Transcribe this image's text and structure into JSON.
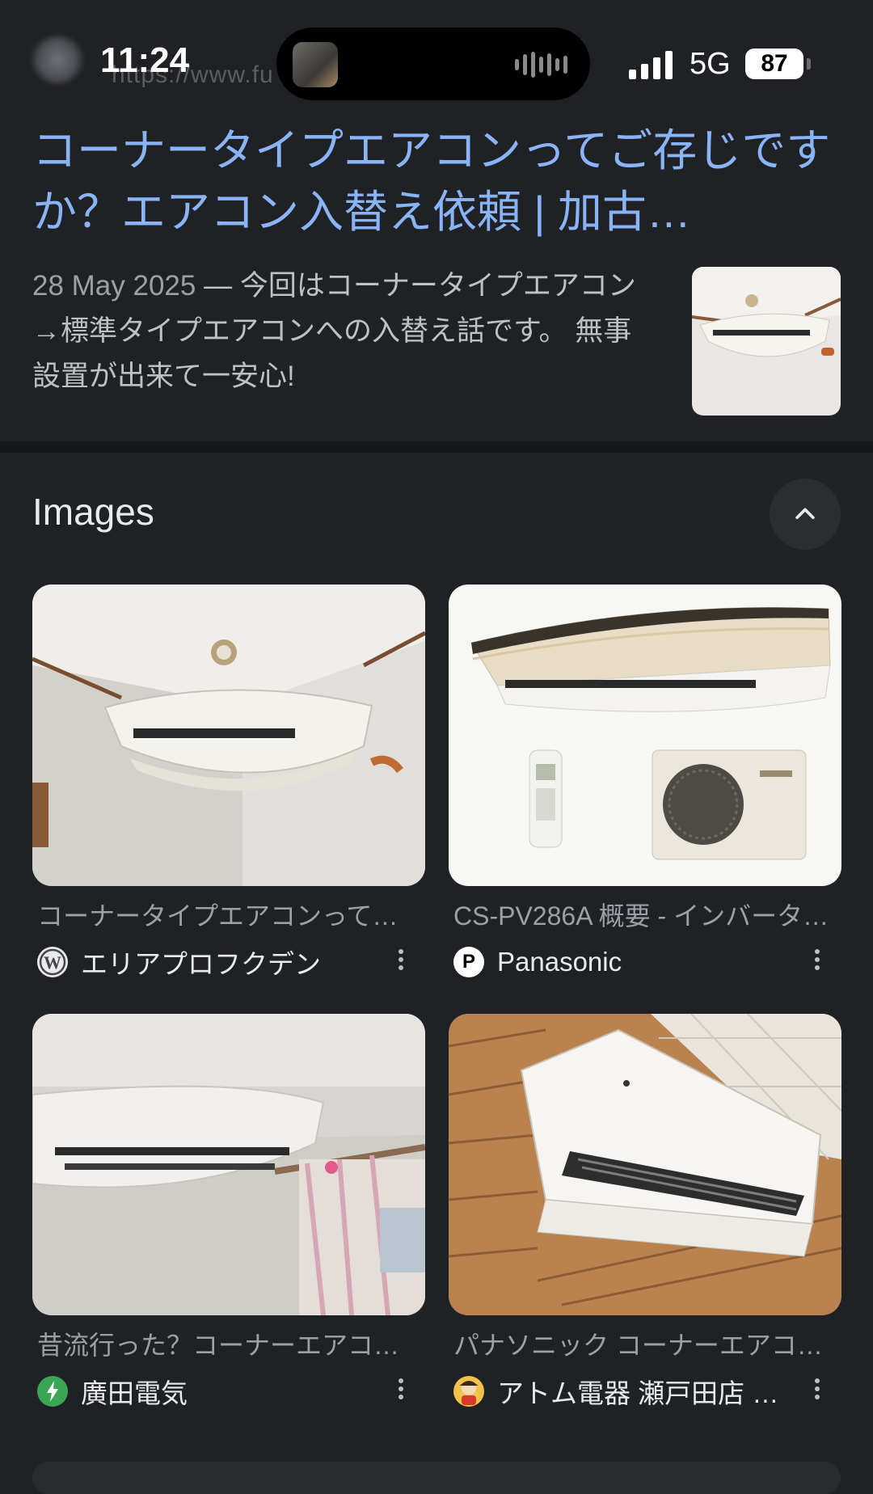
{
  "status_bar": {
    "time": "11:24",
    "blurred_url": "https://www.fu",
    "network": "5G",
    "battery": "87"
  },
  "top_result": {
    "title": "コーナータイプエアコンってご存じですか？エアコン入替え依頼 | 加古…",
    "date": "28 May 2025",
    "separator": " — ",
    "snippet": "今回はコーナータイプエアコン→標準タイプエアコンへの入替え話です。 無事設置が出来て一安心!"
  },
  "images_section": {
    "heading": "Images",
    "collapse_icon": "chevron-up-icon",
    "cards": [
      {
        "caption": "コーナータイプエアコンって…",
        "source": "エリアプロフクデン",
        "favicon": "wordpress-icon"
      },
      {
        "caption": "CS-PV286A 概要 - インバータ…",
        "source": "Panasonic",
        "favicon_letter": "P"
      },
      {
        "caption": "昔流行った？コーナーエアコ…",
        "source": "廣田電気",
        "favicon": "leaf-bolt-icon"
      },
      {
        "caption": "パナソニック コーナーエアコ…",
        "source": "アトム電器 瀬戸田店 …",
        "favicon": "mascot-icon"
      }
    ]
  },
  "colors": {
    "background": "#202124",
    "link": "#8ab4f8",
    "snippet_text": "#bdc1c6",
    "muted_text": "#9aa0a6"
  }
}
